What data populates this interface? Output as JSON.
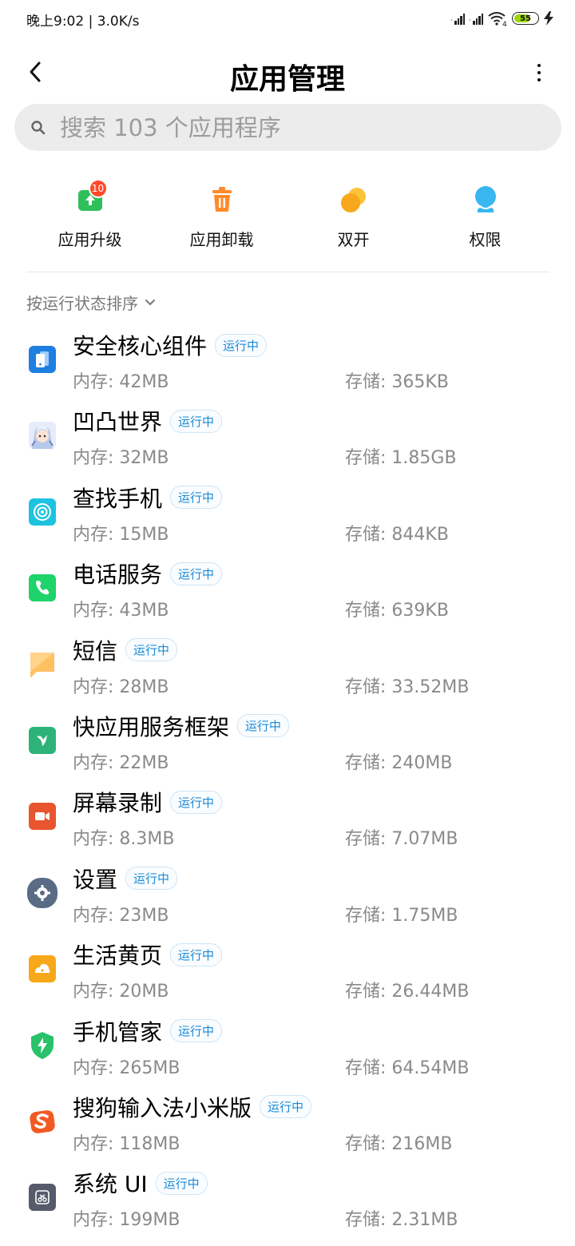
{
  "status_bar": {
    "time_speed": "晚上9:02 | 3.0K/s",
    "wifi_label": "4",
    "battery_level": "55",
    "battery_color": "#9ad600"
  },
  "header": {
    "title": "应用管理"
  },
  "search": {
    "placeholder": "搜索 103 个应用程序"
  },
  "quick_actions": [
    {
      "label": "应用升级",
      "icon": "upgrade-icon",
      "badge": "10",
      "color": "#2fbf5b"
    },
    {
      "label": "应用卸载",
      "icon": "trash-icon",
      "color": "#ff8a2a"
    },
    {
      "label": "双开",
      "icon": "dual-app-icon",
      "color": "#f7b51c"
    },
    {
      "label": "权限",
      "icon": "permission-icon",
      "color": "#3ab6f0"
    }
  ],
  "sort": {
    "label": "按运行状态排序"
  },
  "running_tag": "运行中",
  "apps": [
    {
      "name": "安全核心组件",
      "memory": "内存: 42MB",
      "storage": "存储: 365KB",
      "icon": "security-core-icon",
      "color": "#1e7fe0"
    },
    {
      "name": "凹凸世界",
      "memory": "内存: 32MB",
      "storage": "存储: 1.85GB",
      "icon": "aotu-world-icon",
      "color": "#c9d6ee"
    },
    {
      "name": "查找手机",
      "memory": "内存: 15MB",
      "storage": "存储: 844KB",
      "icon": "find-phone-icon",
      "color": "#1ec3e0"
    },
    {
      "name": "电话服务",
      "memory": "内存: 43MB",
      "storage": "存储: 639KB",
      "icon": "phone-icon",
      "color": "#1dd36a"
    },
    {
      "name": "短信",
      "memory": "内存: 28MB",
      "storage": "存储: 33.52MB",
      "icon": "sms-icon",
      "color": "#ffc061"
    },
    {
      "name": "快应用服务框架",
      "memory": "内存: 22MB",
      "storage": "存储: 240MB",
      "icon": "quick-app-icon",
      "color": "#2db37a"
    },
    {
      "name": "屏幕录制",
      "memory": "内存: 8.3MB",
      "storage": "存储: 7.07MB",
      "icon": "screen-record-icon",
      "color": "#e8552e"
    },
    {
      "name": "设置",
      "memory": "内存: 23MB",
      "storage": "存储: 1.75MB",
      "icon": "settings-icon",
      "color": "#5a6b86"
    },
    {
      "name": "生活黄页",
      "memory": "内存: 20MB",
      "storage": "存储: 26.44MB",
      "icon": "yellow-pages-icon",
      "color": "#f6a81a"
    },
    {
      "name": "手机管家",
      "memory": "内存: 265MB",
      "storage": "存储: 64.54MB",
      "icon": "security-shield-icon",
      "color": "#28c26a"
    },
    {
      "name": "搜狗输入法小米版",
      "memory": "内存: 118MB",
      "storage": "存储: 216MB",
      "icon": "sogou-icon",
      "color": "#f25a24"
    },
    {
      "name": "系统 UI",
      "memory": "内存: 199MB",
      "storage": "存储: 2.31MB",
      "icon": "system-ui-icon",
      "color": "#565b6b"
    }
  ]
}
